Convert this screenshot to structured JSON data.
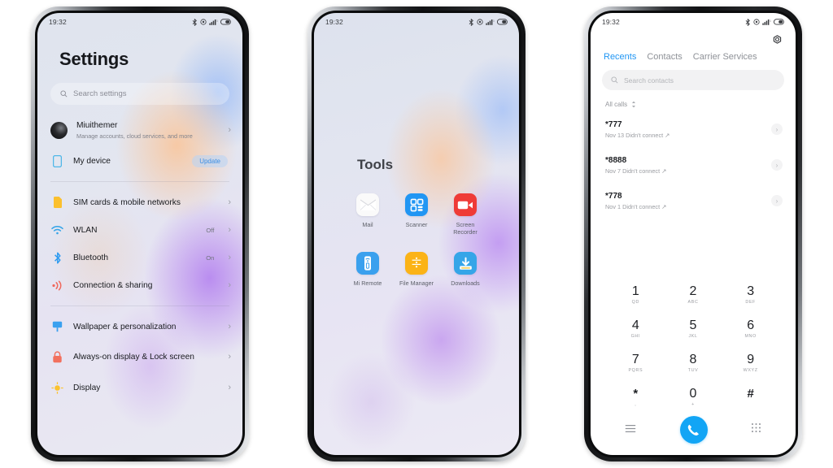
{
  "status_bar": {
    "time": "19:32",
    "icons": [
      "bluetooth-icon",
      "alarm-icon",
      "signal-icon",
      "battery-icon"
    ]
  },
  "phone1": {
    "name": "settings-screen",
    "title": "Settings",
    "search": {
      "placeholder": "Search settings",
      "icon": "search-icon"
    },
    "account": {
      "name": "Miuithemer",
      "subtitle": "Manage accounts, cloud services, and more",
      "avatar": "user-avatar"
    },
    "groups": [
      {
        "items": [
          {
            "label": "My device",
            "icon": "device-icon",
            "icon_color": "#4fb7e8",
            "badge": "Update",
            "value": ""
          }
        ]
      },
      {
        "items": [
          {
            "label": "SIM cards & mobile networks",
            "icon": "sim-icon",
            "icon_color": "#fbc02d",
            "value": ""
          },
          {
            "label": "WLAN",
            "icon": "wifi-icon",
            "icon_color": "#35a4e8",
            "value": "Off"
          },
          {
            "label": "Bluetooth",
            "icon": "bluetooth-icon",
            "icon_color": "#2e9bf0",
            "value": "On"
          },
          {
            "label": "Connection & sharing",
            "icon": "connection-sharing-icon",
            "icon_color": "#f0685c",
            "value": ""
          }
        ]
      },
      {
        "items": [
          {
            "label": "Wallpaper & personalization",
            "icon": "wallpaper-icon",
            "icon_color": "#3aa0ef",
            "value": ""
          },
          {
            "label": "Always-on display & Lock screen",
            "icon": "lock-icon",
            "icon_color": "#f2705e",
            "value": ""
          },
          {
            "label": "Display",
            "icon": "display-icon",
            "icon_color": "#fbc230",
            "value": ""
          }
        ]
      }
    ],
    "chevron": "›"
  },
  "phone2": {
    "name": "tools-folder-screen",
    "folder_title": "Tools",
    "apps": [
      {
        "label": "Mail",
        "icon": "mail-icon",
        "bg": "#fafafa"
      },
      {
        "label": "Scanner",
        "icon": "scanner-icon",
        "bg": "#2196f3"
      },
      {
        "label": "Screen Recorder",
        "icon": "screen-recorder-icon",
        "bg": "#ef3b37"
      },
      {
        "label": "Mi Remote",
        "icon": "mi-remote-icon",
        "bg": "#3aa0ee"
      },
      {
        "label": "File Manager",
        "icon": "file-manager-icon",
        "bg": "#fbb317"
      },
      {
        "label": "Downloads",
        "icon": "downloads-icon",
        "bg": "#36a5e8"
      }
    ]
  },
  "phone3": {
    "name": "dialer-screen",
    "settings_icon": "gear-icon",
    "tabs": [
      {
        "label": "Recents",
        "active": true
      },
      {
        "label": "Contacts",
        "active": false
      },
      {
        "label": "Carrier Services",
        "active": false
      }
    ],
    "search": {
      "placeholder": "Search contacts",
      "icon": "search-icon"
    },
    "filter": {
      "label": "All calls",
      "icon": "sort-icon"
    },
    "calls": [
      {
        "number": "*777",
        "meta": "Nov 13 Didn't connect ↗"
      },
      {
        "number": "*8888",
        "meta": "Nov 7 Didn't connect ↗"
      },
      {
        "number": "*778",
        "meta": "Nov 1 Didn't connect ↗"
      }
    ],
    "keypad": [
      {
        "digit": "1",
        "letters": "QD"
      },
      {
        "digit": "2",
        "letters": "ABC"
      },
      {
        "digit": "3",
        "letters": "DEF"
      },
      {
        "digit": "4",
        "letters": "GHI"
      },
      {
        "digit": "5",
        "letters": "JKL"
      },
      {
        "digit": "6",
        "letters": "MNO"
      },
      {
        "digit": "7",
        "letters": "PQRS"
      },
      {
        "digit": "8",
        "letters": "TUV"
      },
      {
        "digit": "9",
        "letters": "WXYZ"
      },
      {
        "digit": "*",
        "letters": ","
      },
      {
        "digit": "0",
        "letters": "+"
      },
      {
        "digit": "#",
        "letters": ""
      }
    ],
    "bottom_bar": {
      "left_icon": "menu-icon",
      "call_icon": "call-icon",
      "right_icon": "keypad-icon"
    },
    "accent_color": "#12a5f5"
  }
}
